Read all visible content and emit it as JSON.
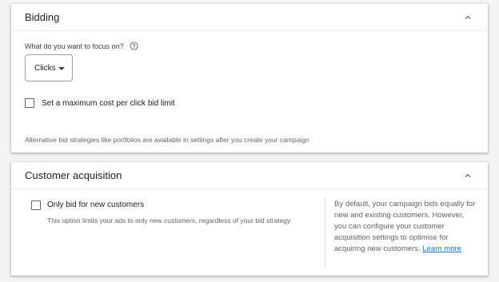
{
  "bidding": {
    "title": "Bidding",
    "question": "What do you want to focus on?",
    "focus_selected": "Clicks",
    "max_cpc_label": "Set a maximum cost per click bid limit",
    "footnote": "Alternative bid strategies like portfolios are available in settings after you create your campaign"
  },
  "customer_acquisition": {
    "title": "Customer acquisition",
    "new_customers_label": "Only bid for new customers",
    "helper": "This option limits your ads to only new customers, regardless of your bid strategy",
    "description": "By default, your campaign bids equally for new and existing customers. However, you can configure your customer acquisition settings to optimise for acquiring new customers.",
    "learn_more": "Learn more"
  },
  "icons": {
    "collapse": "chevron-up-icon",
    "help": "help-circle-icon",
    "dropdown": "arrow-drop-down-icon"
  },
  "colors": {
    "link": "#1a73e8",
    "background": "#f1f3f4"
  }
}
